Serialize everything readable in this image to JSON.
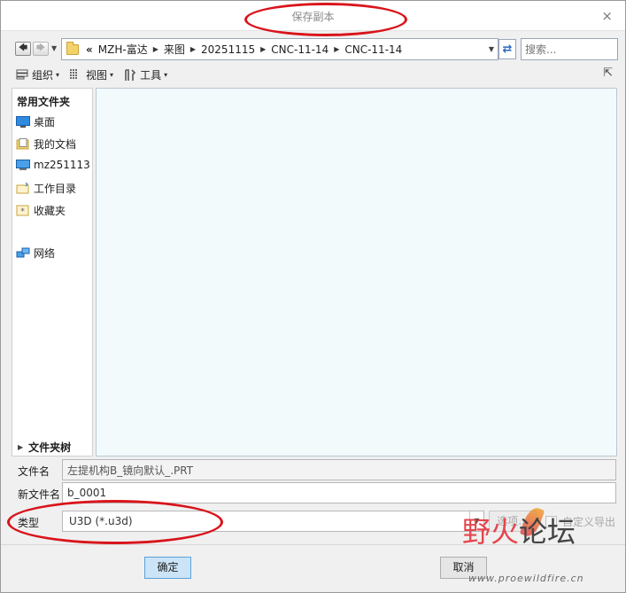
{
  "window": {
    "title": "保存副本",
    "close_glyph": "×"
  },
  "nav": {
    "back_glyph": "🡄",
    "forward_glyph": "🡆",
    "dropdown_glyph": "▼",
    "address_prefix": "«",
    "breadcrumbs": [
      "MZH-富达",
      "来图",
      "20251115",
      "CNC-11-14",
      "CNC-11-14"
    ],
    "crumb_separator": "▶",
    "refresh_glyph": "⇄",
    "search_placeholder": "搜索..."
  },
  "toolbar": {
    "organize": "组织",
    "view": "视图",
    "tools": "工具",
    "caret": "▾",
    "help_glyph": "⇱"
  },
  "sidebar": {
    "header": "常用文件夹",
    "items": [
      {
        "label": "桌面",
        "icon": "desktop-icon"
      },
      {
        "label": "我的文档",
        "icon": "documents-icon"
      },
      {
        "label": "mz251113",
        "icon": "computer-icon"
      },
      {
        "label": "工作目录",
        "icon": "working-directory-icon"
      },
      {
        "label": "收藏夹",
        "icon": "favorites-icon"
      },
      {
        "label": "网络",
        "icon": "network-icon"
      }
    ],
    "tree_label": "文件夹树",
    "tree_glyph": "▶"
  },
  "form": {
    "filename_label": "文件名",
    "filename_value": "左提机构B_镜向默认_.PRT",
    "newname_label": "新文件名",
    "newname_value": "b_0001",
    "type_label": "类型",
    "type_value": "U3D (*.u3d)",
    "options_label": "选项...",
    "custom_export_label": "自定义导出"
  },
  "buttons": {
    "ok": "确定",
    "cancel": "取消"
  },
  "watermark": {
    "brand_part1": "野",
    "brand_part2": "火",
    "brand_part3": "论坛",
    "url": "www.proewildfire.cn"
  },
  "colors": {
    "annotation_red": "#d9141b",
    "ok_button_blue": "#cce4f7",
    "file_area_bg": "#f3fafc"
  }
}
